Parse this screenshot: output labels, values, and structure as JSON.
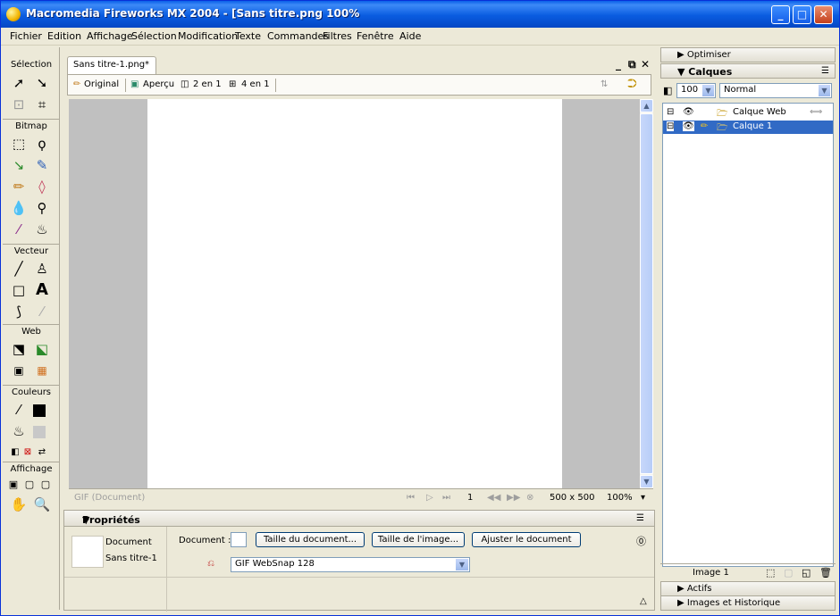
{
  "window": {
    "title": "Macromedia Fireworks MX 2004 - [Sans titre.png  100%"
  },
  "menu": [
    "Fichier",
    "Edition",
    "Affichage",
    "Sélection",
    "Modification",
    "Texte",
    "Commandes",
    "Filtres",
    "Fenêtre",
    "Aide"
  ],
  "tools": {
    "sections": [
      "Sélection",
      "Bitmap",
      "Vecteur",
      "Web",
      "Couleurs",
      "Affichage"
    ]
  },
  "document": {
    "tab": "Sans titre-1.png*",
    "views": [
      "Original",
      "Aperçu",
      "2 en 1",
      "4 en 1"
    ]
  },
  "status": {
    "format": "GIF (Document)",
    "frame": "1",
    "size": "500 x 500",
    "zoom": "100%"
  },
  "properties": {
    "header": "Propriétés",
    "type": "Document",
    "name": "Sans titre-1",
    "doc_label": "Document :",
    "btn_doc_size": "Taille du document...",
    "btn_image_size": "Taille de l'image...",
    "btn_fit": "Ajuster le document",
    "optimize_value": "GIF WebSnap 128"
  },
  "right_panels": {
    "optimize": "Optimiser",
    "layers": "Calques",
    "opacity": "100",
    "blend": "Normal",
    "layer_items": [
      {
        "name": "Calque Web"
      },
      {
        "name": "Calque 1"
      }
    ],
    "frame_label": "Image 1",
    "assets": "Actifs",
    "history": "Images et Historique"
  }
}
